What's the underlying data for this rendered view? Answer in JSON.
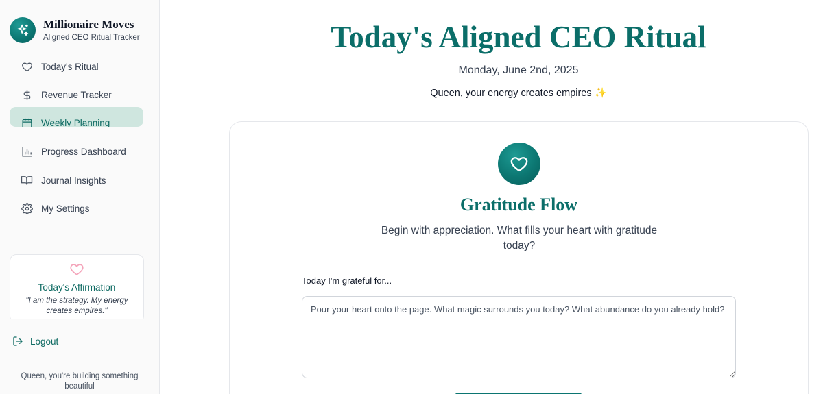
{
  "brand": {
    "title": "Millionaire Moves",
    "subtitle": "Aligned CEO Ritual Tracker",
    "icon": "sparkles-icon"
  },
  "sidebar": {
    "items": [
      {
        "label": "Today's Ritual",
        "icon": "heart-icon",
        "active": false
      },
      {
        "label": "Revenue Tracker",
        "icon": "dollar-icon",
        "active": false
      },
      {
        "label": "Weekly Planning",
        "icon": "calendar-icon",
        "active": true
      },
      {
        "label": "Progress Dashboard",
        "icon": "bar-chart-icon",
        "active": false
      },
      {
        "label": "Journal Insights",
        "icon": "book-open-icon",
        "active": false
      },
      {
        "label": "My Settings",
        "icon": "gear-icon",
        "active": false
      }
    ],
    "affirmation": {
      "title": "Today's Affirmation",
      "quote": "\"I am the strategy. My energy creates empires.\""
    },
    "logout_label": "Logout",
    "footer_note": "Queen, you're building something beautiful"
  },
  "main": {
    "title": "Today's Aligned CEO Ritual",
    "date": "Monday, June 2nd, 2025",
    "tagline": "Queen, your energy creates empires ✨"
  },
  "card": {
    "icon": "heart-icon",
    "title": "Gratitude Flow",
    "description": "Begin with appreciation. What fills your heart with gratitude today?",
    "field_label": "Today I'm grateful for...",
    "placeholder": "Pour your heart onto the page. What magic surrounds you today? What abundance do you already hold?",
    "value": ""
  },
  "colors": {
    "accent": "#0b6e69",
    "active_nav_bg": "#cfe6df",
    "affirmation_heart": "#f4a3b9"
  }
}
